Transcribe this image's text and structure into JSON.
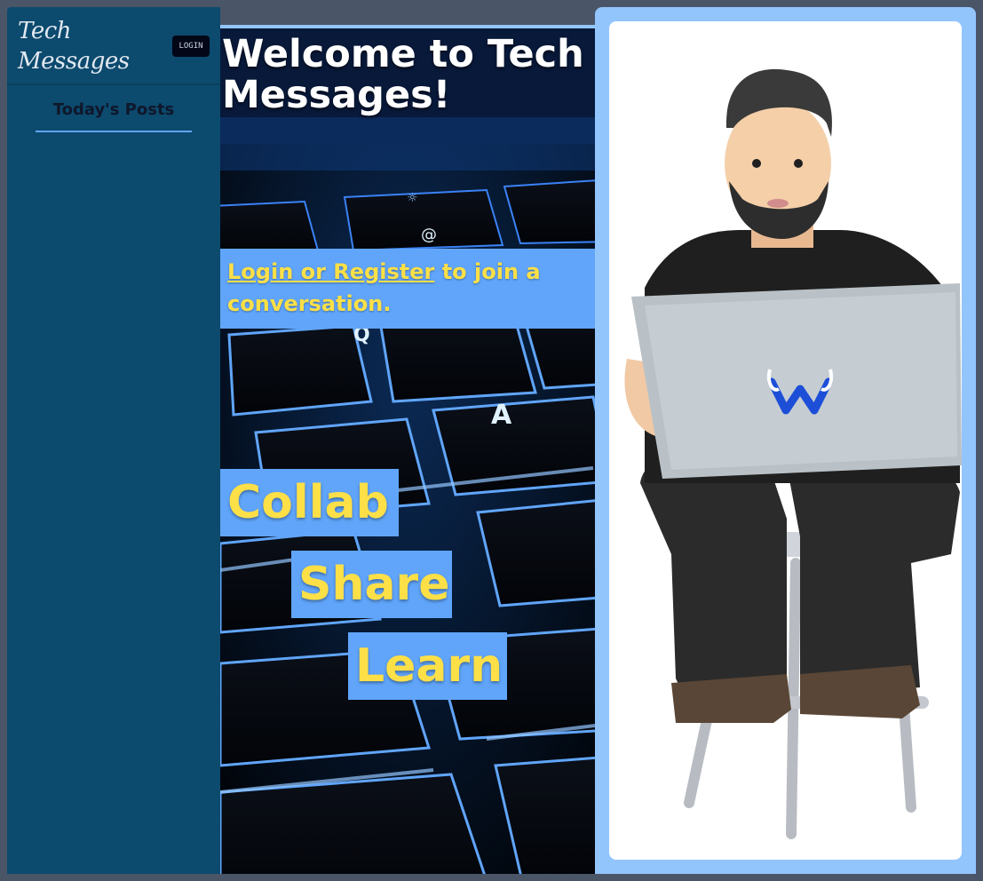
{
  "sidebar": {
    "brand_line1": "Tech",
    "brand_line2": "Messages",
    "login_label": "LOGIN",
    "nav_items": [
      {
        "label": "Today's Posts"
      }
    ]
  },
  "hero": {
    "title": "Welcome to Tech Messages!",
    "cta_link": "Login or Register",
    "cta_rest": " to join a conversation.",
    "words": [
      "Collab",
      "Share",
      "Learn"
    ]
  },
  "colors": {
    "page_bg": "#4a5568",
    "sidebar_bg": "#0c4a6e",
    "accent_blue": "#60a5fa",
    "light_blue": "#93c5fd",
    "accent_yellow": "#fde047"
  }
}
